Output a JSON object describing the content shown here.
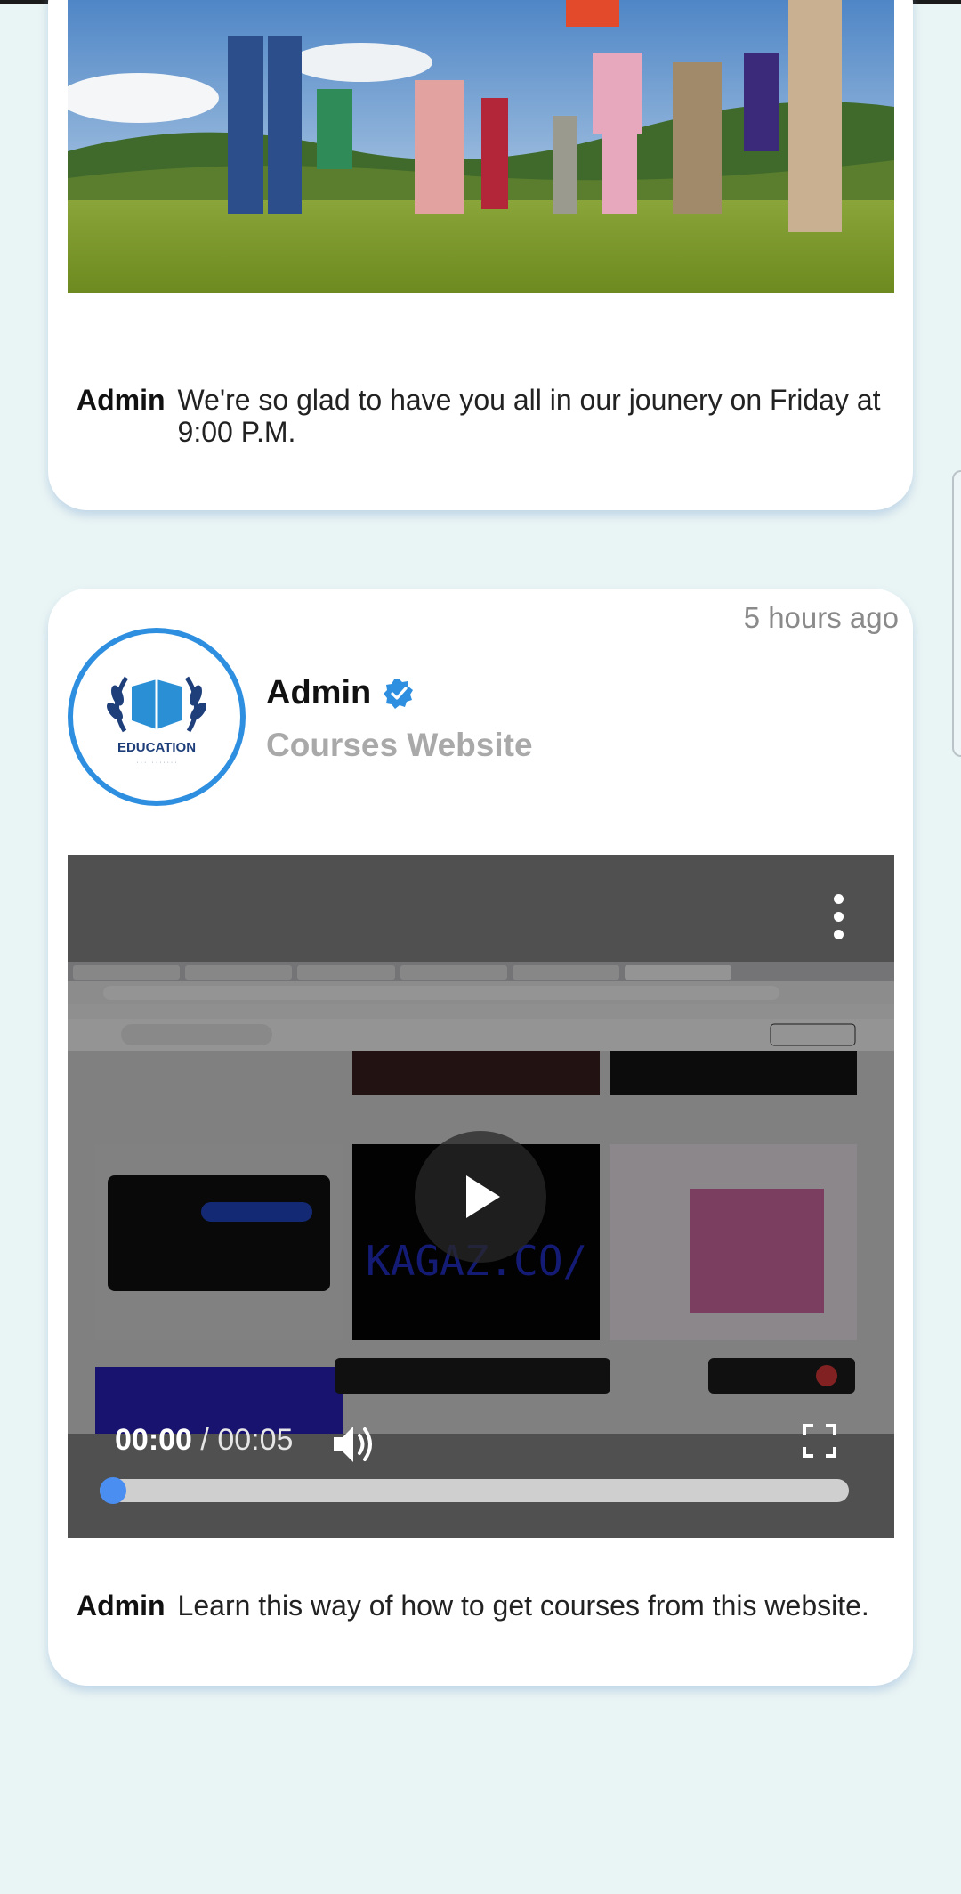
{
  "posts": [
    {
      "author": "Admin",
      "caption": "We're so glad to have you all in our jounery on Friday at 9:00 P.M.",
      "media": "photo"
    },
    {
      "time_ago": "5 hours ago",
      "author": "Admin",
      "verified_icon": "verified-badge-icon",
      "subtitle": "Courses Website",
      "avatar_text": "EDUCATION",
      "video": {
        "current_time": "00:00",
        "separator": " / ",
        "duration": "00:05",
        "progress": 0.0
      },
      "caption": "Learn this way of how to get courses from this website."
    }
  ],
  "colors": {
    "accent": "#2e8fe0",
    "progress_knob": "#4a8ef2",
    "background": "#e9f4f4"
  }
}
